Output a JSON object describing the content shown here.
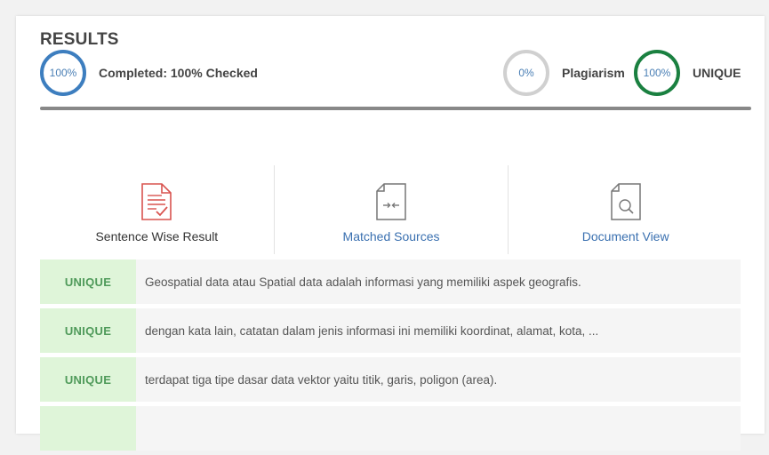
{
  "results": {
    "title": "RESULTS",
    "completed_pct": "100%",
    "completed_label": "Completed: 100% Checked",
    "plagiarism_pct": "0%",
    "plagiarism_label": "Plagiarism",
    "unique_pct": "100%",
    "unique_label": "UNIQUE",
    "progress": 1.0
  },
  "tabs": [
    {
      "label": "Sentence Wise Result",
      "icon": "document-check-icon"
    },
    {
      "label": "Matched Sources",
      "icon": "compare-arrows-file-icon"
    },
    {
      "label": "Document View",
      "icon": "document-search-icon"
    }
  ],
  "rows": [
    {
      "badge": "UNIQUE",
      "text": "Geospatial data atau Spatial data adalah informasi yang memiliki aspek geografis."
    },
    {
      "badge": "UNIQUE",
      "text": "dengan kata lain, catatan dalam jenis informasi ini memiliki koordinat, alamat, kota, ..."
    },
    {
      "badge": "UNIQUE",
      "text": "terdapat tiga tipe dasar data vektor yaitu titik, garis, poligon (area)."
    },
    {
      "badge": "",
      "text": ""
    }
  ],
  "colors": {
    "completed_ring": "#3d7ebf",
    "plagiarism_ring": "#d0d0d0",
    "unique_ring": "#1a8040",
    "unique_badge_bg": "#dff5d9",
    "link": "#3a70b0",
    "active_icon": "#d9534f"
  }
}
